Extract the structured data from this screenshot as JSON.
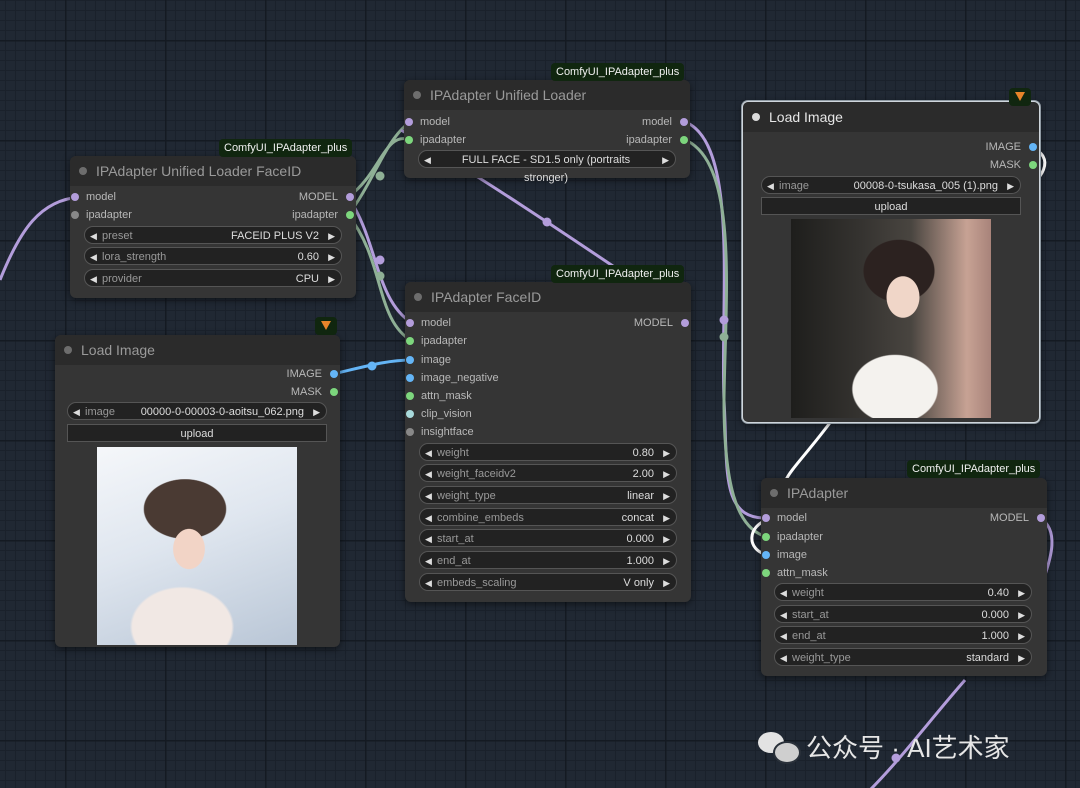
{
  "colors": {
    "model": "#b39ddb",
    "image": "#64b5f6",
    "ipadapter": "#7dd67d",
    "clip_vision": "#a8dadc",
    "insightface": "#888888"
  },
  "badges": {
    "unified_loader": "ComfyUI_IPAdapter_plus",
    "loader_faceid": "ComfyUI_IPAdapter_plus",
    "faceid": "ComfyUI_IPAdapter_plus",
    "ipadapter": "ComfyUI_IPAdapter_plus"
  },
  "unified_loader": {
    "title": "IPAdapter Unified Loader",
    "in_model": "model",
    "in_ipadapter": "ipadapter",
    "out_model": "model",
    "out_ipadapter": "ipadapter",
    "preset": "FULL FACE - SD1.5 only (portraits stronger)"
  },
  "loader_faceid": {
    "title": "IPAdapter Unified Loader FaceID",
    "in_model": "model",
    "in_ipadapter": "ipadapter",
    "out_model": "MODEL",
    "out_ipadapter": "ipadapter",
    "widgets": [
      {
        "label": "preset",
        "value": "FACEID PLUS V2"
      },
      {
        "label": "lora_strength",
        "value": "0.60"
      },
      {
        "label": "provider",
        "value": "CPU"
      }
    ]
  },
  "load_image_left": {
    "title": "Load Image",
    "out_image": "IMAGE",
    "out_mask": "MASK",
    "image_label": "image",
    "image_value": "00000-0-00003-0-aoitsu_062.png",
    "upload": "upload"
  },
  "faceid": {
    "title": "IPAdapter FaceID",
    "inputs": [
      "model",
      "ipadapter",
      "image",
      "image_negative",
      "attn_mask",
      "clip_vision",
      "insightface"
    ],
    "out_model": "MODEL",
    "widgets": [
      {
        "label": "weight",
        "value": "0.80"
      },
      {
        "label": "weight_faceidv2",
        "value": "2.00"
      },
      {
        "label": "weight_type",
        "value": "linear"
      },
      {
        "label": "combine_embeds",
        "value": "concat"
      },
      {
        "label": "start_at",
        "value": "0.000"
      },
      {
        "label": "end_at",
        "value": "1.000"
      },
      {
        "label": "embeds_scaling",
        "value": "V only"
      }
    ]
  },
  "load_image_right": {
    "title": "Load Image",
    "out_image": "IMAGE",
    "out_mask": "MASK",
    "image_label": "image",
    "image_value": "00008-0-tsukasa_005 (1).png",
    "upload": "upload"
  },
  "ipadapter": {
    "title": "IPAdapter",
    "inputs": [
      "model",
      "ipadapter",
      "image",
      "attn_mask"
    ],
    "out_model": "MODEL",
    "widgets": [
      {
        "label": "weight",
        "value": "0.40"
      },
      {
        "label": "start_at",
        "value": "0.000"
      },
      {
        "label": "end_at",
        "value": "1.000"
      },
      {
        "label": "weight_type",
        "value": "standard"
      }
    ]
  },
  "watermark": {
    "text": "公众号 · AI艺术家"
  }
}
